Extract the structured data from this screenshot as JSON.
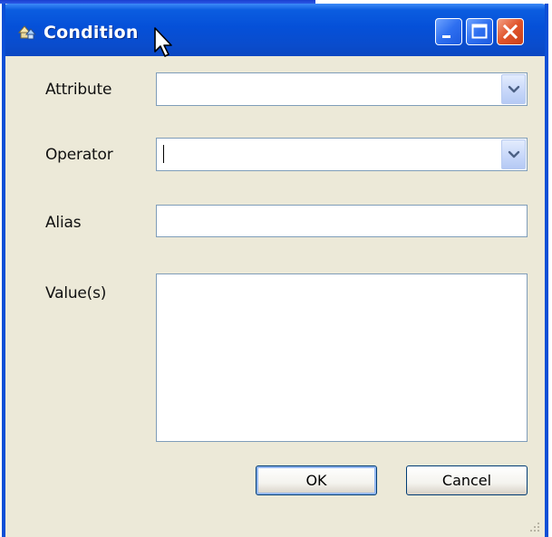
{
  "window": {
    "title": "Condition",
    "icon": "condition-app-icon",
    "controls": [
      "minimize-icon",
      "maximize-icon",
      "close-icon"
    ]
  },
  "form": {
    "attribute_label": "Attribute",
    "attribute_value": "",
    "operator_label": "Operator",
    "operator_value": "",
    "alias_label": "Alias",
    "alias_value": "",
    "values_label": "Value(s)",
    "values_value": ""
  },
  "buttons": {
    "ok_label": "OK",
    "cancel_label": "Cancel"
  },
  "colors": {
    "titlebar": "#0550d8",
    "window_bg": "#ece9d8",
    "field_border": "#7f9db9",
    "close_button": "#e0532a"
  }
}
